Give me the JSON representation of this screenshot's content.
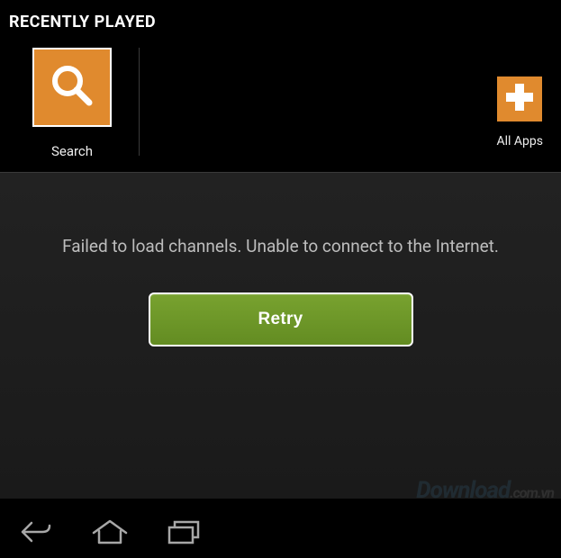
{
  "header": {
    "title": "RECENTLY PLAYED"
  },
  "toolbar": {
    "search_label": "Search",
    "allapps_label": "All Apps"
  },
  "error": {
    "message": "Failed to load channels. Unable to connect to the Internet.",
    "retry_label": "Retry"
  },
  "watermark": {
    "main": "Download",
    "suffix": ".com.vn"
  },
  "colors": {
    "accent": "#e08a2e",
    "button": "#6f9827",
    "dots": [
      "#4aa3d1",
      "#999999",
      "#8fb438",
      "#e2a23a",
      "#3e76c2",
      "#c23a3a"
    ]
  }
}
